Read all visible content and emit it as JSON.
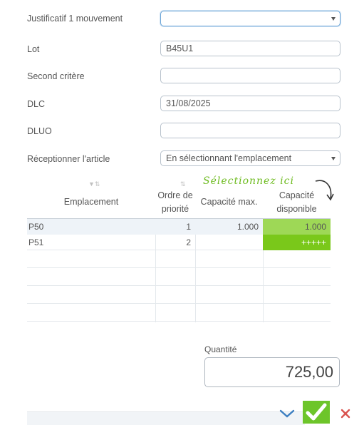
{
  "form": {
    "justificatif": {
      "label": "Justificatif 1 mouvement",
      "value": ""
    },
    "lot": {
      "label": "Lot",
      "value": "B45U1"
    },
    "second": {
      "label": "Second critère",
      "value": ""
    },
    "dlc": {
      "label": "DLC",
      "value": "31/08/2025"
    },
    "dluo": {
      "label": "DLUO",
      "value": ""
    },
    "reception": {
      "label": "Réceptionner l'article",
      "value": "En sélectionnant l'emplacement"
    }
  },
  "annotation": "Sélectionnez ici",
  "grid": {
    "headers": {
      "emplacement": "Emplacement",
      "ordre_line1": "Ordre de",
      "ordre_line2": "priorité",
      "capacite_max": "Capacité max.",
      "capacite_dispo_line1": "Capacité",
      "capacite_dispo_line2": "disponible"
    },
    "rows": [
      {
        "emplacement": "P50",
        "ordre": "1",
        "capacite_max": "1.000",
        "capacite_dispo": "1.000"
      },
      {
        "emplacement": "P51",
        "ordre": "2",
        "capacite_max": "",
        "capacite_dispo": "+++++"
      }
    ]
  },
  "quantite": {
    "label": "Quantité",
    "value": "725,00"
  },
  "actions": {
    "collapse_icon": "chevron-down-icon",
    "validate_icon": "check-icon",
    "cancel_icon": "close-icon"
  },
  "colors": {
    "green_light": "#9ed856",
    "green_dark": "#7ac81a",
    "validate_green": "#6dc52a",
    "cancel_red": "#d9534f",
    "accent_blue": "#3d7fc1"
  }
}
